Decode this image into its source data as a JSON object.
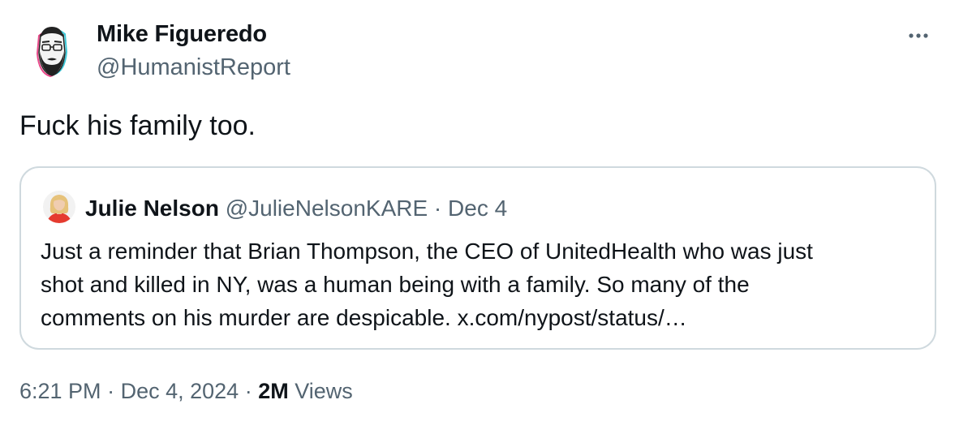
{
  "author": {
    "name": "Mike Figueredo",
    "handle": "@HumanistReport"
  },
  "more_icon": "more-horizontal-icon",
  "tweet_text": "Fuck his family too.",
  "quoted_tweet": {
    "author_name": "Julie Nelson",
    "author_handle": "@JulieNelsonKARE",
    "separator": "·",
    "date": "Dec 4",
    "lines": [
      "Just a reminder that Brian Thompson, the CEO of UnitedHealth who was just",
      "shot and killed in NY, was a human being with a family.  So many of the",
      "comments on his murder are despicable. x.com/nypost/status/…"
    ]
  },
  "meta": {
    "time": "6:21 PM",
    "date": "Dec 4, 2024",
    "separator": "·",
    "views_count": "2M",
    "views_label": "Views"
  },
  "colors": {
    "text": "#0f1419",
    "secondary": "#536471",
    "border": "#cfd9de"
  }
}
